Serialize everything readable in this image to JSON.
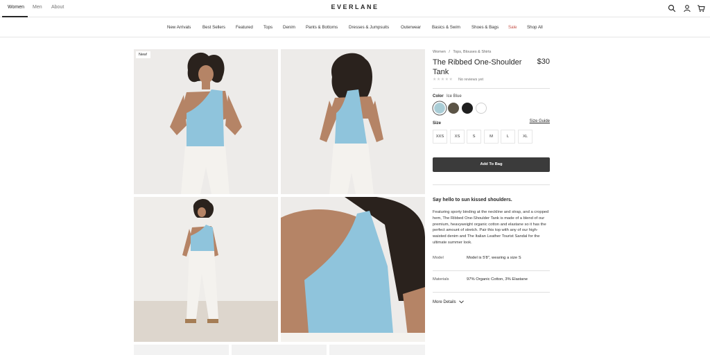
{
  "header": {
    "genders": [
      "Women",
      "Men",
      "About"
    ],
    "logo": "EVERLANE",
    "icons": [
      "search-icon",
      "account-icon",
      "cart-icon"
    ]
  },
  "nav": {
    "categories": [
      "New Arrivals",
      "Best Sellers",
      "Featured",
      "Tops",
      "Denim",
      "Pants & Bottoms",
      "Dresses & Jumpsuits",
      "Outerwear",
      "Basics & Swim",
      "Shoes & Bags",
      "Sale",
      "Shop All"
    ]
  },
  "gallery": {
    "badge": "New!"
  },
  "product": {
    "breadcrumb": [
      "Women",
      "/",
      "Tops, Blouses & Shirts"
    ],
    "title": "The Ribbed One-Shoulder Tank",
    "price": "$30",
    "stars": "★★★★★",
    "reviews": "No reviews yet",
    "color_label": "Color",
    "color_value": "Ice Blue",
    "swatches": [
      "#a9cdd6",
      "#5b5446",
      "#1f1f1f",
      "#ffffff"
    ],
    "size_label": "Size",
    "size_guide": "Size Guide",
    "sizes": [
      "XXS",
      "XS",
      "S",
      "M",
      "L",
      "XL"
    ],
    "add_to_bag": "Add To Bag",
    "headline": "Say hello to sun kissed shoulders.",
    "description": "Featuring sporty binding at the neckline and strap, and a cropped hem, The Ribbed One-Shoulder Tank is made of a blend of our premium, heavyweight organic cotton and elastane so it has the perfect amount of stretch. Pair this top with any of our high-waisted denim and The Italian Leather Tourist Sandal for the ultimate summer look.",
    "specs": [
      {
        "key": "Model",
        "value": "Model is 5'8\", wearing a size S"
      },
      {
        "key": "Materials",
        "value": "97% Organic Cotton, 3% Elastane"
      }
    ],
    "more_details": "More Details"
  },
  "colors": {
    "accent_sale": "#c5534a",
    "button_dark": "#3b3b3b",
    "tank_blue": "#8fc4dc"
  }
}
